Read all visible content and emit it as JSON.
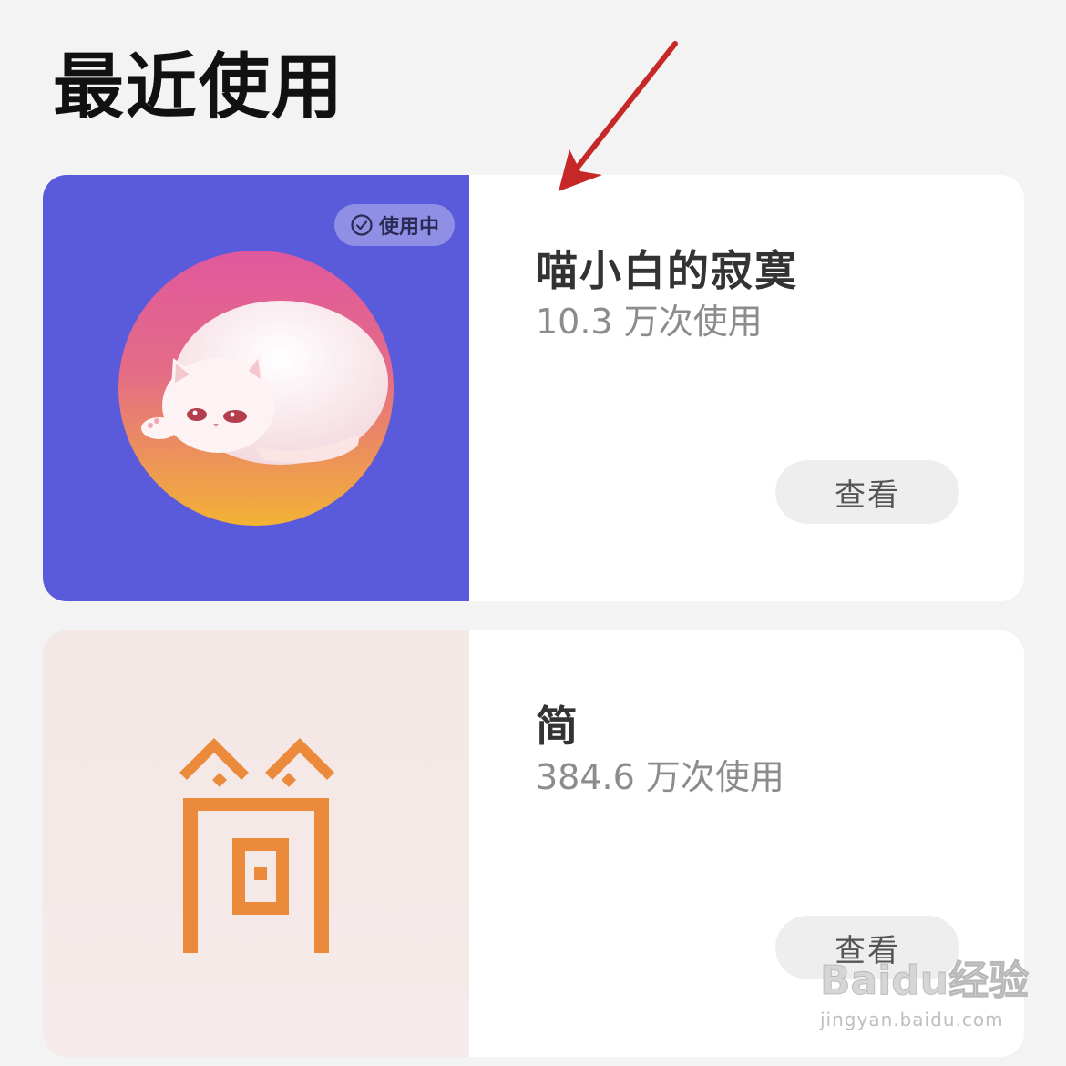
{
  "section_title": "最近使用",
  "cards": [
    {
      "name": "喵小白的寂寞",
      "usage": "10.3 万次使用",
      "badge": "使用中",
      "button": "查看",
      "thumb_color": "#5a5bdb"
    },
    {
      "name": "简",
      "usage": "384.6 万次使用",
      "button": "查看",
      "logo_color": "#ec8a3c"
    }
  ],
  "watermark": {
    "main": "Baidu经验",
    "sub": "jingyan.baidu.com"
  },
  "colors": {
    "annotation_arrow": "#c62828",
    "background": "#f3f3f3"
  }
}
